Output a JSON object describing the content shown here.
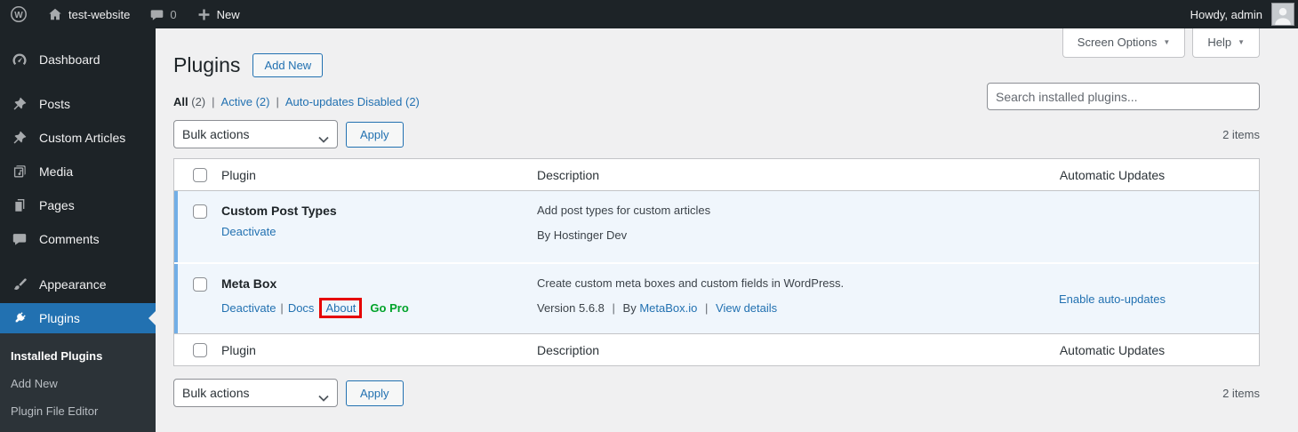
{
  "colors": {
    "accent": "#2271b1",
    "admin_dark": "#1d2327",
    "highlight_red": "#e60000",
    "go_pro_green": "#00a32a",
    "active_row_bg": "#f0f6fc",
    "active_row_stripe": "#72aee6"
  },
  "admin_bar": {
    "site_name": "test-website",
    "comment_count": "0",
    "new_label": "New",
    "howdy_text": "Howdy, admin"
  },
  "sidebar": {
    "items": [
      {
        "label": "Dashboard",
        "icon": "dashboard-icon"
      },
      {
        "label": "Posts",
        "icon": "pin-icon"
      },
      {
        "label": "Custom Articles",
        "icon": "pin-icon"
      },
      {
        "label": "Media",
        "icon": "media-icon"
      },
      {
        "label": "Pages",
        "icon": "pages-icon"
      },
      {
        "label": "Comments",
        "icon": "comments-icon"
      },
      {
        "label": "Appearance",
        "icon": "appearance-icon"
      },
      {
        "label": "Plugins",
        "icon": "plugins-icon",
        "active": true
      }
    ],
    "submenu": [
      {
        "label": "Installed Plugins",
        "current": true
      },
      {
        "label": "Add New"
      },
      {
        "label": "Plugin File Editor"
      }
    ]
  },
  "page": {
    "title": "Plugins",
    "add_new_button": "Add New",
    "screen_options_label": "Screen Options",
    "help_label": "Help"
  },
  "filters": {
    "all_label": "All",
    "all_count": "(2)",
    "active_label": "Active",
    "active_count": "(2)",
    "autoupdates_label": "Auto-updates Disabled",
    "autoupdates_count": "(2)"
  },
  "toolbar": {
    "bulk_actions_label": "Bulk actions",
    "apply_label": "Apply",
    "items_count": "2 items",
    "search_placeholder": "Search installed plugins..."
  },
  "table": {
    "columns": {
      "plugin": "Plugin",
      "description": "Description",
      "auto_updates": "Automatic Updates"
    },
    "rows": [
      {
        "name": "Custom Post Types",
        "action_deactivate": "Deactivate",
        "description": "Add post types for custom articles",
        "byline": "By Hostinger Dev",
        "auto_updates_link": ""
      },
      {
        "name": "Meta Box",
        "action_deactivate": "Deactivate",
        "action_docs": "Docs",
        "action_about": "About",
        "action_gopro": "Go Pro",
        "description": "Create custom meta boxes and custom fields in WordPress.",
        "version_text": "Version 5.6.8",
        "by_label": "By",
        "author_link": "MetaBox.io",
        "details_link": "View details",
        "auto_updates_link": "Enable auto-updates"
      }
    ]
  },
  "ui": {
    "pipe": "|",
    "caret_down": "▼"
  }
}
